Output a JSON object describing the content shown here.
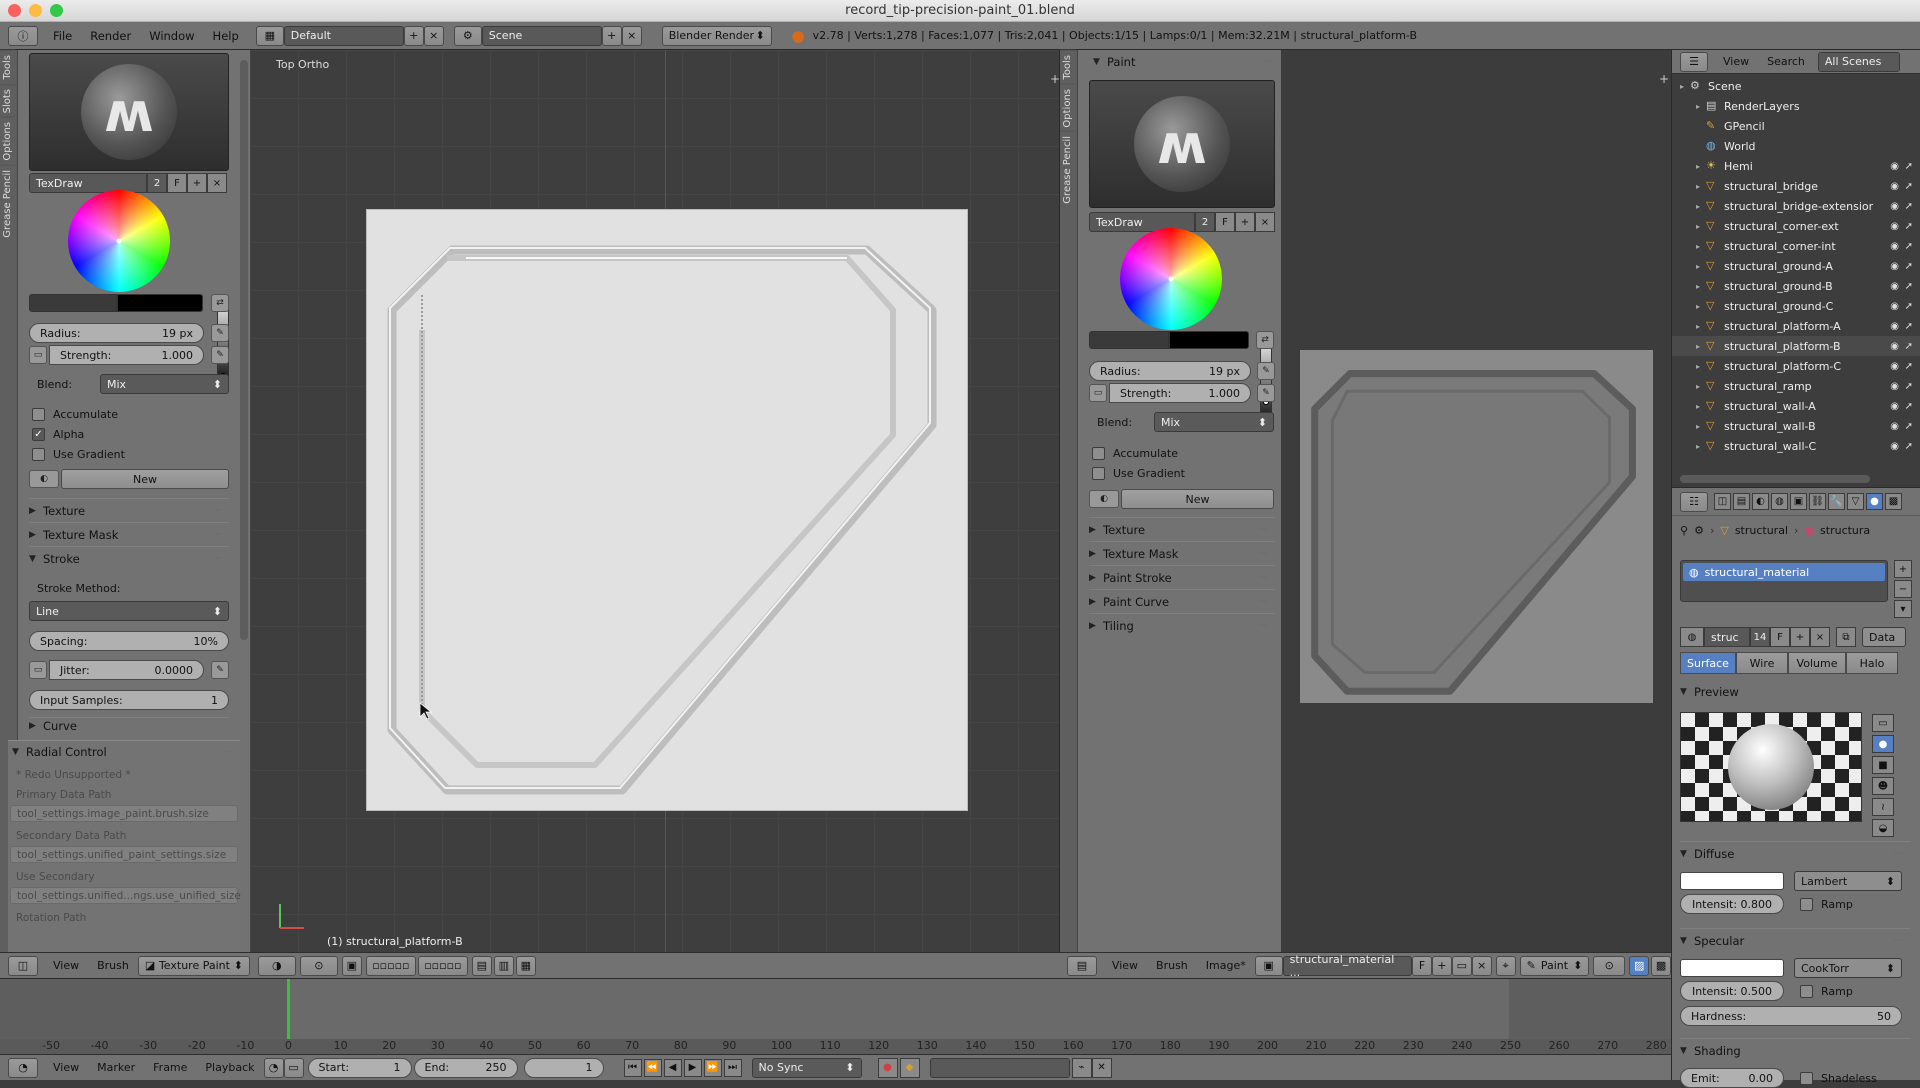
{
  "window": {
    "title": "record_tip-precision-paint_01.blend"
  },
  "info_header": {
    "menus": [
      "File",
      "Render",
      "Window",
      "Help"
    ],
    "layout": "Default",
    "scene": "Scene",
    "engine": "Blender Render",
    "stats": "v2.78 | Verts:1,278 | Faces:1,077 | Tris:2,041 | Objects:1/15 | Lamps:0/1 | Mem:32.21M | structural_platform-B"
  },
  "left_tool_shelf": {
    "vertical_tabs": [
      "Tools",
      "Slots",
      "Options",
      "Grease Pencil"
    ],
    "brush_name": "TexDraw",
    "brush_users": "2",
    "fake_user": "F",
    "radius_label": "Radius:",
    "radius_value": "19 px",
    "strength_label": "Strength:",
    "strength_value": "1.000",
    "blend_label": "Blend:",
    "blend_value": "Mix",
    "accumulate": "Accumulate",
    "alpha": "Alpha",
    "use_gradient": "Use Gradient",
    "new_button": "New",
    "sections": [
      "Texture",
      "Texture Mask",
      "Stroke"
    ],
    "stroke_method_label": "Stroke Method:",
    "stroke_method_value": "Line",
    "spacing_label": "Spacing:",
    "spacing_value": "10%",
    "jitter_label": "Jitter:",
    "jitter_value": "0.0000",
    "input_samples_label": "Input Samples:",
    "input_samples_value": "1",
    "curve_section": "Curve"
  },
  "redo_panel": {
    "title": "Radial Control",
    "unsupported": "* Redo Unsupported *",
    "fields": [
      {
        "label": "Primary Data Path",
        "value": "tool_settings.image_paint.brush.size"
      },
      {
        "label": "Secondary Data Path",
        "value": "tool_settings.unified_paint_settings.size"
      },
      {
        "label": "Use Secondary",
        "value": "tool_settings.unified...ngs.use_unified_size"
      },
      {
        "label": "Rotation Path",
        "value": ""
      }
    ]
  },
  "viewport3d": {
    "view_label": "Top Ortho",
    "object_label": "(1) structural_platform-B",
    "menus": [
      "View",
      "Brush"
    ],
    "mode": "Texture Paint"
  },
  "image_editor_tools": {
    "vertical_tabs": [
      "Tools",
      "Options",
      "Grease Pencil"
    ],
    "panel_title": "Paint",
    "brush_name": "TexDraw",
    "brush_users": "2",
    "fake_user": "F",
    "radius_label": "Radius:",
    "radius_value": "19 px",
    "strength_label": "Strength:",
    "strength_value": "1.000",
    "blend_label": "Blend:",
    "blend_value": "Mix",
    "accumulate": "Accumulate",
    "use_gradient": "Use Gradient",
    "new_button": "New",
    "sections": [
      "Texture",
      "Texture Mask",
      "Paint Stroke",
      "Paint Curve",
      "Tiling"
    ]
  },
  "image_editor": {
    "menus": [
      "View",
      "Brush",
      "Image*"
    ],
    "image_name": "structural_material ...",
    "fake_user": "F",
    "mode": "Paint"
  },
  "outliner": {
    "menus": [
      "View",
      "Search"
    ],
    "filter": "All Scenes",
    "items": [
      {
        "name": "Scene",
        "type": "scene",
        "depth": 0
      },
      {
        "name": "RenderLayers",
        "type": "renderlayers",
        "depth": 1
      },
      {
        "name": "GPencil",
        "type": "gpencil",
        "depth": 1
      },
      {
        "name": "World",
        "type": "world",
        "depth": 1
      },
      {
        "name": "Hemi",
        "type": "lamp",
        "depth": 1
      },
      {
        "name": "structural_bridge",
        "type": "mesh",
        "depth": 1
      },
      {
        "name": "structural_bridge-extensior",
        "type": "mesh",
        "depth": 1
      },
      {
        "name": "structural_corner-ext",
        "type": "mesh",
        "depth": 1
      },
      {
        "name": "structural_corner-int",
        "type": "mesh",
        "depth": 1
      },
      {
        "name": "structural_ground-A",
        "type": "mesh",
        "depth": 1
      },
      {
        "name": "structural_ground-B",
        "type": "mesh",
        "depth": 1
      },
      {
        "name": "structural_ground-C",
        "type": "mesh",
        "depth": 1
      },
      {
        "name": "structural_platform-A",
        "type": "mesh",
        "depth": 1
      },
      {
        "name": "structural_platform-B",
        "type": "mesh",
        "depth": 1
      },
      {
        "name": "structural_platform-C",
        "type": "mesh",
        "depth": 1
      },
      {
        "name": "structural_ramp",
        "type": "mesh",
        "depth": 1
      },
      {
        "name": "structural_wall-A",
        "type": "mesh",
        "depth": 1
      },
      {
        "name": "structural_wall-B",
        "type": "mesh",
        "depth": 1
      },
      {
        "name": "structural_wall-C",
        "type": "mesh",
        "depth": 1
      }
    ]
  },
  "properties": {
    "breadcrumb": [
      "structural",
      "structura"
    ],
    "material_slot": "structural_material",
    "material_field": "struc",
    "material_users": "14",
    "fake_user": "F",
    "data_select": "Data",
    "tabs": [
      "Surface",
      "Wire",
      "Volume",
      "Halo"
    ],
    "preview_section": "Preview",
    "diffuse_section": "Diffuse",
    "diffuse_shader": "Lambert",
    "diffuse_intensity": "Intensit: 0.800",
    "ramp": "Ramp",
    "specular_section": "Specular",
    "specular_shader": "CookTorr",
    "specular_intensity": "Intensit: 0.500",
    "hardness_label": "Hardness:",
    "hardness_value": "50",
    "shading_section": "Shading",
    "emit": "Emit:",
    "emit_value": "0.00",
    "shadeless": "Shadeless"
  },
  "timeline": {
    "ticks": [
      "-50",
      "-40",
      "-30",
      "-20",
      "-10",
      "0",
      "10",
      "20",
      "30",
      "40",
      "50",
      "60",
      "70",
      "80",
      "90",
      "100",
      "110",
      "120",
      "130",
      "140",
      "150",
      "160",
      "170",
      "180",
      "190",
      "200",
      "210",
      "220",
      "230",
      "240",
      "250",
      "260",
      "270",
      "280"
    ],
    "menus": [
      "View",
      "Marker",
      "Frame",
      "Playback"
    ],
    "start_label": "Start:",
    "start_value": "1",
    "end_label": "End:",
    "end_value": "250",
    "current_frame": "1",
    "sync": "No Sync"
  },
  "colors": {
    "panel": "#727272",
    "viewport": "#3e3e3e",
    "accent_blue": "#5680c2",
    "mesh_orange": "#e39a39",
    "current_frame": "#3dbf3d"
  }
}
